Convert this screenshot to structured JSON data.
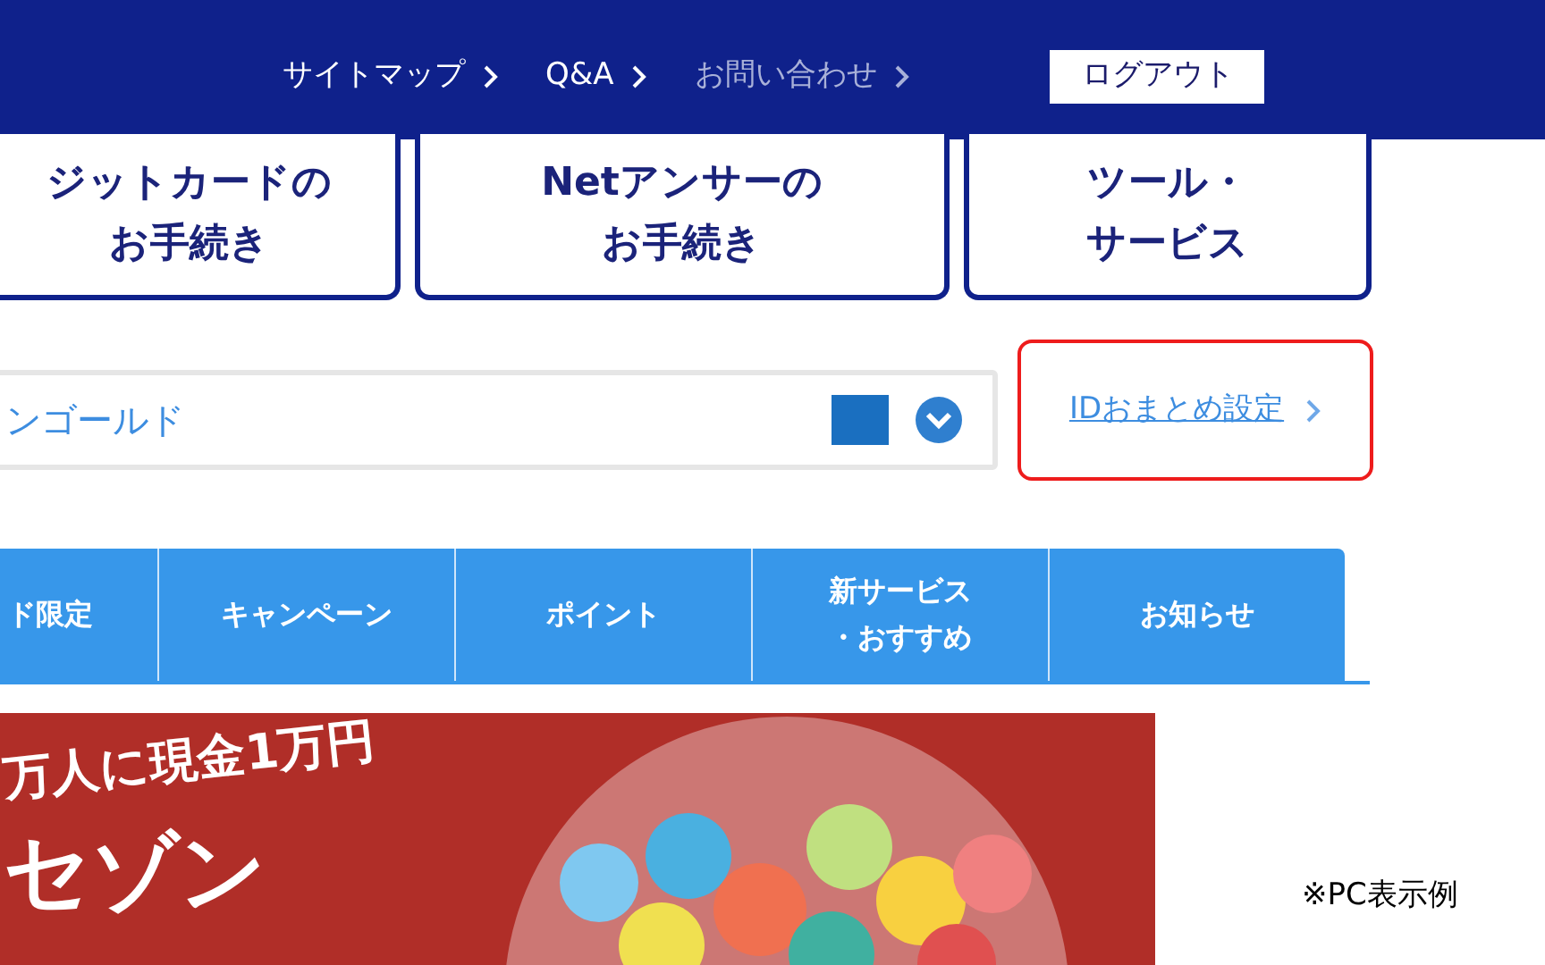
{
  "header_nav": [
    {
      "label": "サイトマップ",
      "disabled": false
    },
    {
      "label": "Q&A",
      "disabled": false
    },
    {
      "label": "お問い合わせ",
      "disabled": true
    }
  ],
  "logout_button": "ログアウト",
  "menu_cards": [
    [
      "ジットカードの",
      "お手続き"
    ],
    [
      "Netアンサーの",
      "お手続き"
    ],
    [
      "ツール・",
      "サービス"
    ]
  ],
  "card_select": {
    "value": "ンゴールド"
  },
  "id_link": "IDおまとめ設定",
  "tabs": [
    [
      "ド限定"
    ],
    [
      "キャンペーン"
    ],
    [
      "ポイント"
    ],
    [
      "新サービス",
      "・おすすめ"
    ],
    [
      "お知らせ"
    ]
  ],
  "banner": {
    "line_1": "万人に現金1万円",
    "line_2": "セゾン"
  },
  "note": "※PC表示例"
}
